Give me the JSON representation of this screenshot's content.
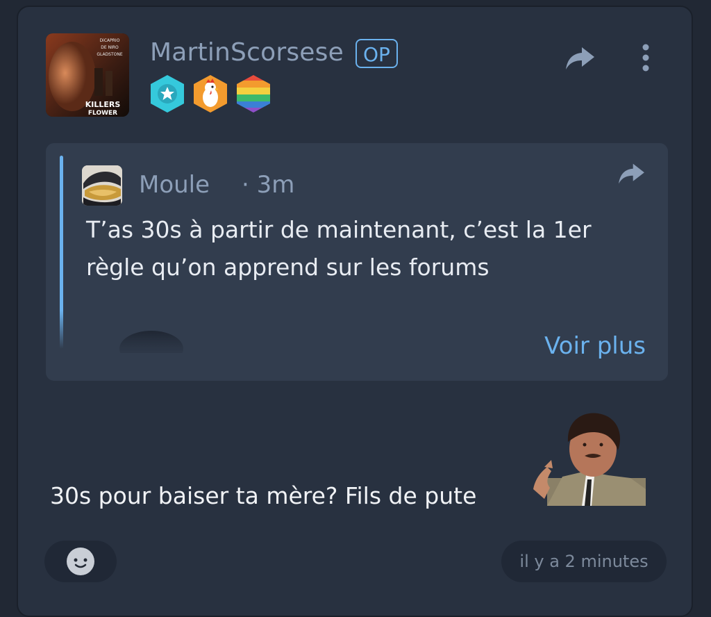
{
  "post": {
    "author": "MartinScorsese",
    "op_label": "OP",
    "avatar_text": {
      "line1": "KILLERS",
      "line2": "FLOWER",
      "names": [
        "DiCAPRIO",
        "DE NIRO",
        "GLADSTONE"
      ]
    },
    "badges": [
      {
        "icon": "star-badge-icon",
        "color": "#35c9dc"
      },
      {
        "icon": "rooster-badge-icon",
        "color": "#f39b2e"
      },
      {
        "icon": "rainbow-badge-icon",
        "color": "#e84c3c"
      }
    ],
    "message": "30s pour baiser ta mère? Fils de pute",
    "timestamp": "il y a 2 minutes"
  },
  "quote": {
    "author": "Moule",
    "time": "· 3m",
    "text": "T’as 30s à partir de maintenant, c’est la 1er règle qu’on apprend sur les forums",
    "more_label": "Voir plus"
  },
  "colors": {
    "accent": "#6bb2ee",
    "card_bg": "#283140",
    "quote_bg": "#323d4e",
    "muted": "#8d9fb8"
  }
}
